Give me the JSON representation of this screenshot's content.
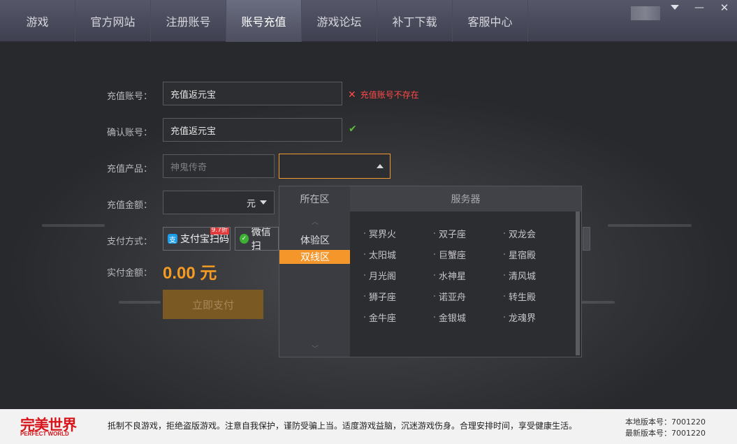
{
  "nav": {
    "tabs": [
      {
        "label": "游戏"
      },
      {
        "label": "官方网站"
      },
      {
        "label": "注册账号"
      },
      {
        "label": "账号充值"
      },
      {
        "label": "补丁下载"
      },
      {
        "label": "游戏论坛"
      },
      {
        "label": "客服中心"
      }
    ],
    "tabs_order_fix": [
      "游戏",
      "官方网站",
      "注册账号",
      "账号充值",
      "游戏论坛",
      "补丁下载",
      "客服中心"
    ],
    "active_tab": "账号充值",
    "window": {
      "menu_icon": "chevron-down-icon",
      "minimize_icon": "minimize-icon",
      "close_icon": "close-icon",
      "minimize_glyph": "—",
      "close_glyph": "✕"
    }
  },
  "form": {
    "account_label": "充值账号：",
    "account_value": "充值返元宝",
    "account_error": "充值账号不存在",
    "confirm_label": "确认账号：",
    "confirm_value": "充值返元宝",
    "product_label": "充值产品：",
    "product_value": "神鬼传奇",
    "amount_label": "充值金额：",
    "amount_unit": "元",
    "pay_method_label": "支付方式：",
    "alipay_label": "支付宝扫码",
    "alipay_badge": "9.7折",
    "wechat_label": "微信扫",
    "paid_label": "实付金额：",
    "paid_amount": "0.00 元",
    "submit_label": "立即支付"
  },
  "dropdown": {
    "zone_header": "所在区",
    "server_header": "服务器",
    "zones": [
      "体验区",
      "双线区"
    ],
    "selected_zone": "双线区",
    "servers": [
      "冥界火",
      "双子座",
      "双龙会",
      "太阳城",
      "巨蟹座",
      "星宿殿",
      "月光阁",
      "水神星",
      "清风城",
      "狮子座",
      "诺亚舟",
      "转生殿",
      "金牛座",
      "金银城",
      "龙魂界"
    ]
  },
  "footer": {
    "logo_cn": "完美世界",
    "logo_en": "PERFECT WORLD",
    "notice": "抵制不良游戏，拒绝盗版游戏。注意自我保护，谨防受骗上当。适度游戏益脑，沉迷游戏伤身。合理安排时间，享受健康生活。",
    "local_version_label": "本地版本号：",
    "local_version": "7001220",
    "latest_version_label": "最新版本号：",
    "latest_version": "7001220"
  },
  "colors": {
    "accent": "#f5962a",
    "error": "#ff4a4a",
    "ok": "#5fbf3a",
    "brand": "#d7141a"
  }
}
